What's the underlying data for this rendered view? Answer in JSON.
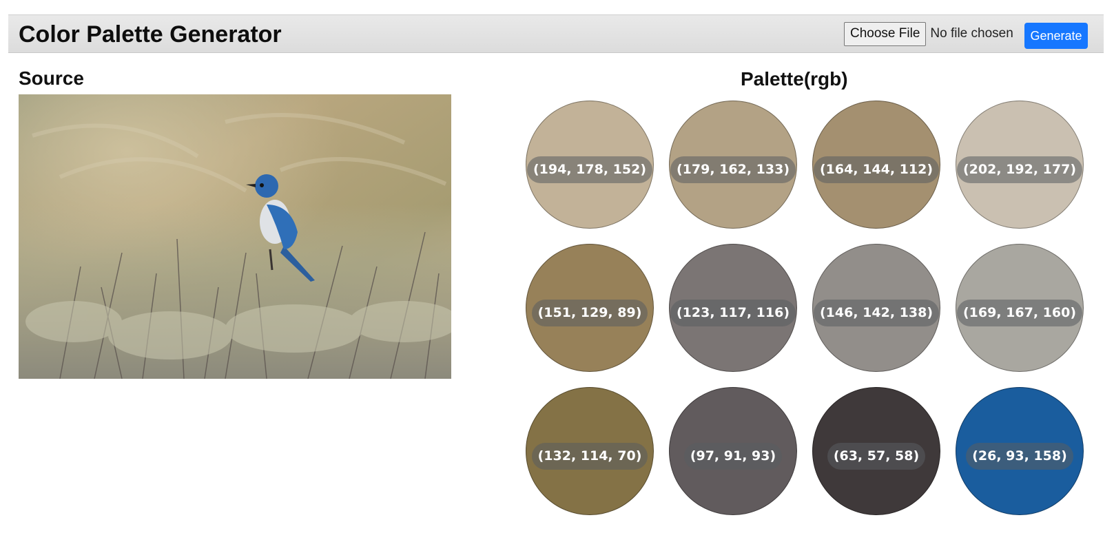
{
  "header": {
    "title": "Color Palette Generator",
    "choose_file_label": "Choose File",
    "file_status": "No file chosen",
    "generate_label": "Generate"
  },
  "source": {
    "title": "Source",
    "image_description": "blue-jay-photo"
  },
  "palette": {
    "title": "Palette(rgb)",
    "swatches": [
      {
        "label": "(194, 178, 152)",
        "color": "#c2b298"
      },
      {
        "label": "(179, 162, 133)",
        "color": "#b3a285"
      },
      {
        "label": "(164, 144, 112)",
        "color": "#a49070"
      },
      {
        "label": "(202, 192, 177)",
        "color": "#cac0b1"
      },
      {
        "label": "(151, 129, 89)",
        "color": "#978159"
      },
      {
        "label": "(123, 117, 116)",
        "color": "#7b7574"
      },
      {
        "label": "(146, 142, 138)",
        "color": "#928e8a"
      },
      {
        "label": "(169, 167, 160)",
        "color": "#a9a7a0"
      },
      {
        "label": "(132, 114, 70)",
        "color": "#847246"
      },
      {
        "label": "(97, 91, 93)",
        "color": "#615b5d"
      },
      {
        "label": "(63, 57, 58)",
        "color": "#3f393a"
      },
      {
        "label": "(26, 93, 158)",
        "color": "#1a5d9e"
      }
    ]
  }
}
